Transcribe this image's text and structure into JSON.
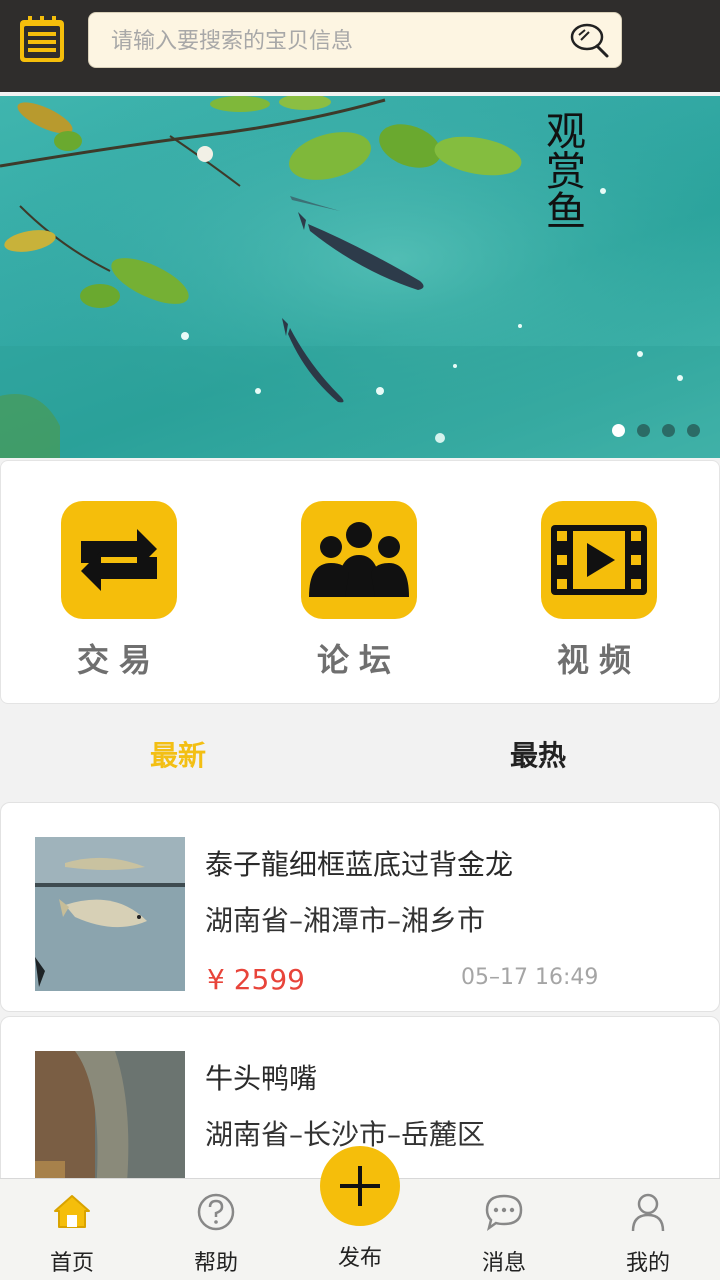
{
  "search": {
    "placeholder": "请输入要搜索的宝贝信息",
    "menu_icon": "notepad-menu-icon",
    "search_icon": "magnifier-icon"
  },
  "banner": {
    "title": "观赏鱼",
    "slide_count": 4,
    "active_slide": 1
  },
  "quick_links": [
    {
      "label": "交易",
      "icon": "swap-arrows-icon"
    },
    {
      "label": "论坛",
      "icon": "group-people-icon"
    },
    {
      "label": "视频",
      "icon": "film-play-icon"
    }
  ],
  "tabs": {
    "latest": "最新",
    "hottest": "最热",
    "active": "latest"
  },
  "listings": [
    {
      "title": "泰子龍细框蓝底过背金龙",
      "location": "湖南省–湘潭市–湘乡市",
      "price": "¥ 2599",
      "time": "05–17 16:49"
    },
    {
      "title": "牛头鸭嘴",
      "location": "湖南省–长沙市–岳麓区"
    }
  ],
  "bottom_nav": {
    "home": "首页",
    "help": "帮助",
    "publish": "发布",
    "messages": "消息",
    "mine": "我的"
  },
  "colors": {
    "accent": "#f5be0b",
    "topbar": "#2f2d2c",
    "price": "#e8443a",
    "tab_active": "#f3bf14"
  }
}
